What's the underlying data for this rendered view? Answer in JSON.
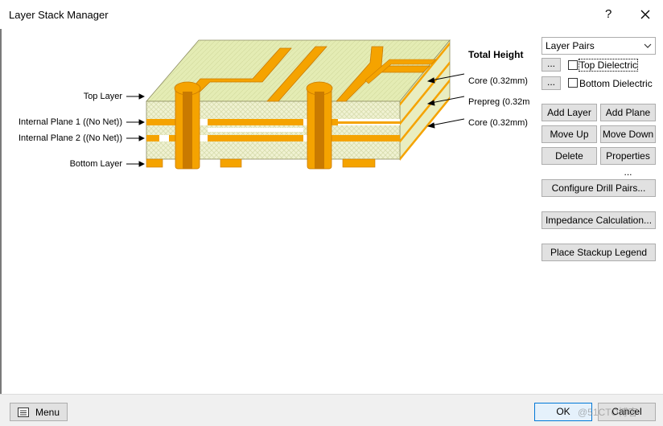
{
  "window": {
    "title": "Layer Stack Manager",
    "help_label": "?"
  },
  "diagram": {
    "total_height_label": "Total Height",
    "left_labels": [
      "Top Layer",
      "Internal Plane 1 ((No Net))",
      "Internal Plane 2 ((No Net))",
      "Bottom Layer"
    ],
    "right_labels": [
      "Core (0.32mm)",
      "Prepreg (0.32m",
      "Core (0.32mm)"
    ],
    "colors": {
      "copper": "#f5a300",
      "copper_dark": "#c97a00",
      "board": "#e4ecb4",
      "board_side": "#f0f2d2"
    }
  },
  "panel": {
    "layer_pairs_value": "Layer Pairs",
    "ellipsis_label": "...",
    "top_dielectric_label": "Top Dielectric",
    "bottom_dielectric_label": "Bottom Dielectric",
    "top_dielectric_checked": false,
    "bottom_dielectric_checked": false,
    "add_layer": "Add Layer",
    "add_plane": "Add Plane",
    "move_up": "Move Up",
    "move_down": "Move Down",
    "delete": "Delete",
    "properties": "Properties ...",
    "configure_drill": "Configure Drill Pairs...",
    "impedance": "Impedance Calculation...",
    "stackup_legend": "Place Stackup Legend"
  },
  "footer": {
    "menu_label": "Menu",
    "ok_label": "OK",
    "cancel_label": "Cancel",
    "watermark": "@51CTO博客"
  }
}
